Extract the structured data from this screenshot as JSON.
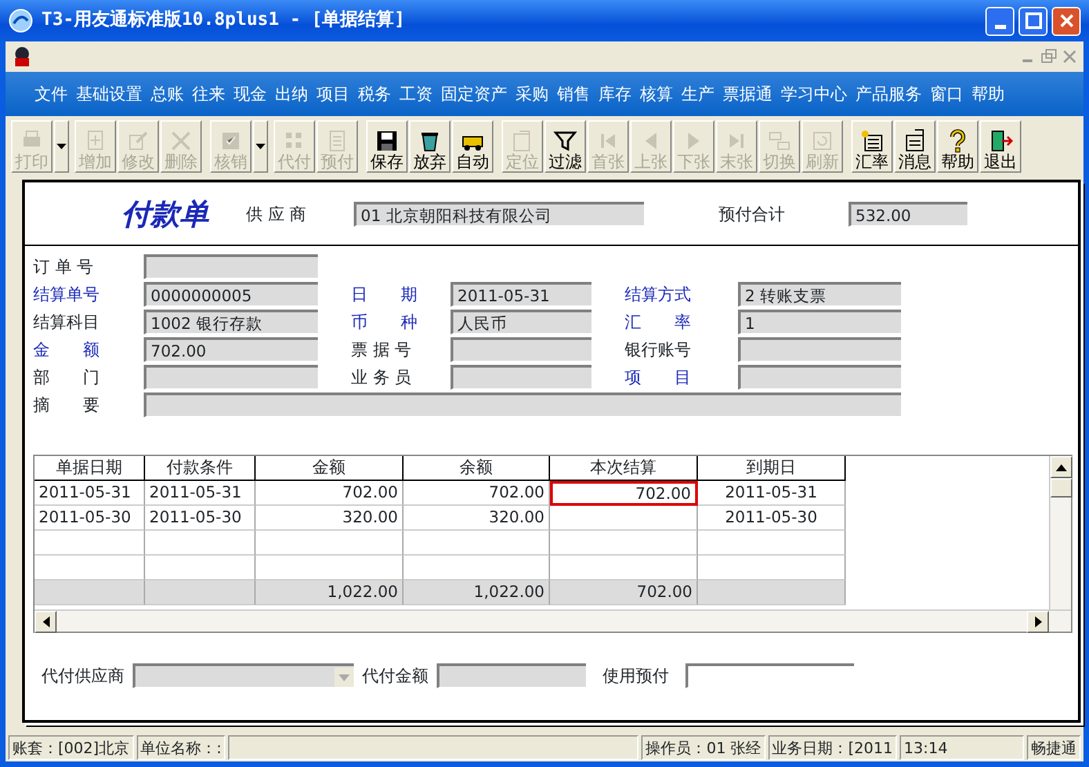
{
  "window": {
    "title": "T3-用友通标准版10.8plus1 - [单据结算]"
  },
  "menu": [
    "文件",
    "基础设置",
    "总账",
    "往来",
    "现金",
    "出纳",
    "项目",
    "税务",
    "工资",
    "固定资产",
    "采购",
    "销售",
    "库存",
    "核算",
    "生产",
    "票据通",
    "学习中心",
    "产品服务",
    "窗口",
    "帮助"
  ],
  "toolbar": [
    {
      "label": "打印",
      "disabled": true,
      "dropdown": true
    },
    {
      "label": "增加",
      "disabled": true
    },
    {
      "label": "修改",
      "disabled": true
    },
    {
      "label": "删除",
      "disabled": true
    },
    {
      "label": "核销",
      "disabled": true,
      "dropdown": true
    },
    {
      "label": "代付",
      "disabled": true
    },
    {
      "label": "预付",
      "disabled": true
    },
    {
      "label": "保存",
      "disabled": false
    },
    {
      "label": "放弃",
      "disabled": false
    },
    {
      "label": "自动",
      "disabled": false
    },
    {
      "label": "定位",
      "disabled": true
    },
    {
      "label": "过滤",
      "disabled": false
    },
    {
      "label": "首张",
      "disabled": true
    },
    {
      "label": "上张",
      "disabled": true
    },
    {
      "label": "下张",
      "disabled": true
    },
    {
      "label": "末张",
      "disabled": true
    },
    {
      "label": "切换",
      "disabled": true
    },
    {
      "label": "刷新",
      "disabled": true
    },
    {
      "label": "汇率",
      "disabled": false
    },
    {
      "label": "消息",
      "disabled": false
    },
    {
      "label": "帮助",
      "disabled": false
    },
    {
      "label": "退出",
      "disabled": false
    }
  ],
  "form": {
    "title": "付款单",
    "supplier": {
      "label": "供 应 商",
      "value": "01  北京朝阳科技有限公司"
    },
    "prepaid_total": {
      "label": "预付合计",
      "value": "532.00"
    },
    "rows": [
      [
        {
          "label": "订 单 号",
          "required": false
        }
      ],
      [
        {
          "label": "结算单号",
          "value": "0000000005",
          "required": true
        },
        {
          "label": "日　　期",
          "value": "2011-05-31",
          "required": true
        },
        {
          "label": "结算方式",
          "value": "2  转账支票",
          "required": true
        }
      ],
      [
        {
          "label": "结算科目",
          "value": "1002  银行存款",
          "required": false
        },
        {
          "label": "币　　种",
          "value": "人民币",
          "required": true
        },
        {
          "label": "汇　　率",
          "value": "1",
          "required": true
        }
      ],
      [
        {
          "label": "金　　额",
          "value": "702.00",
          "required": true
        },
        {
          "label": "票 据 号",
          "required": false
        },
        {
          "label": "银行账号",
          "required": false
        }
      ],
      [
        {
          "label": "部　　门",
          "required": false
        },
        {
          "label": "业 务 员",
          "required": false
        },
        {
          "label": "项　　目",
          "required": true
        }
      ],
      [
        {
          "label": "摘　　要",
          "required": false
        }
      ]
    ]
  },
  "table": {
    "columns": [
      "单据日期",
      "付款条件",
      "金额",
      "余额",
      "本次结算",
      "到期日"
    ],
    "rows": [
      {
        "cells": [
          {
            "text": "2011-05-31",
            "selected": false
          },
          {
            "text": "2011-05-31",
            "selected": false
          },
          {
            "text": "702.00",
            "selected": false
          },
          {
            "text": "702.00",
            "selected": false
          },
          {
            "text": "702.00",
            "selected": true
          },
          {
            "text": "2011-05-31",
            "selected": false
          }
        ]
      },
      {
        "cells": [
          {
            "text": "2011-05-30",
            "selected": false
          },
          {
            "text": "2011-05-30",
            "selected": false
          },
          {
            "text": "320.00",
            "selected": false
          },
          {
            "text": "320.00",
            "selected": false
          },
          {
            "selected": false
          },
          {
            "text": "2011-05-30",
            "selected": false
          }
        ]
      },
      {
        "cells": [
          {
            "selected": false
          },
          {
            "selected": false
          },
          {
            "selected": false
          },
          {
            "selected": false
          },
          {
            "selected": false
          },
          {
            "selected": false
          }
        ]
      },
      {
        "cells": [
          {
            "selected": false
          },
          {
            "selected": false
          },
          {
            "selected": false
          },
          {
            "selected": false
          },
          {
            "selected": false
          },
          {
            "selected": false
          }
        ]
      }
    ],
    "totals": {
      "amount": "1,022.00",
      "balance": "1,022.00",
      "settlement": "702.00"
    }
  },
  "footer": {
    "agent_supplier": {
      "label": "代付供应商",
      "disabled": true
    },
    "agent_amount": {
      "label": "代付金额"
    },
    "use_prepaid": {
      "label": "使用预付"
    }
  },
  "status_bar": {
    "left": [
      "账套：[002]北京",
      "单位名称：:"
    ],
    "right": [
      "操作员：01 张经",
      "业务日期：[2011",
      "13:14",
      "畅捷通"
    ]
  }
}
